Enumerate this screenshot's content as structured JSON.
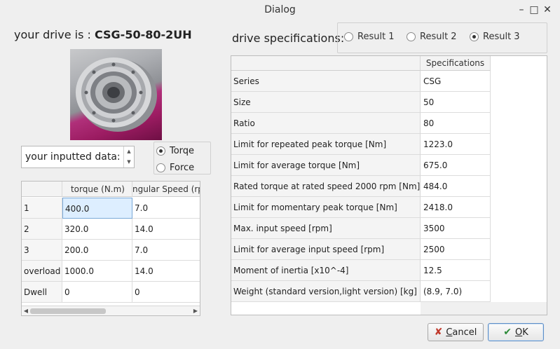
{
  "window": {
    "title": "Dialog",
    "minimize": "–",
    "maximize": "□",
    "close": "✕"
  },
  "drive": {
    "prefix": "your drive is : ",
    "name": "CSG-50-80-2UH"
  },
  "input_spin": {
    "text": "your inputted data:"
  },
  "mode_radios": [
    {
      "label": "Torqe",
      "checked": true
    },
    {
      "label": "Force",
      "checked": false
    }
  ],
  "input_table": {
    "headers": [
      "",
      "torque (N.m)",
      "ngular Speed (rpm"
    ],
    "rows": [
      {
        "label": "1",
        "values": [
          "400.0",
          "7.0"
        ]
      },
      {
        "label": "2",
        "values": [
          "320.0",
          "14.0"
        ]
      },
      {
        "label": "3",
        "values": [
          "200.0",
          "7.0"
        ]
      },
      {
        "label": "overload",
        "values": [
          "1000.0",
          "14.0"
        ]
      },
      {
        "label": "Dwell",
        "values": [
          "0",
          "0"
        ]
      }
    ]
  },
  "spec_label": "drive specifications:",
  "results": [
    {
      "label": "Result 1",
      "checked": false
    },
    {
      "label": "Result 2",
      "checked": false
    },
    {
      "label": "Result 3",
      "checked": true
    }
  ],
  "spec_table": {
    "header": "Specifications",
    "rows": [
      {
        "label": "Series",
        "value": "CSG"
      },
      {
        "label": "Size",
        "value": "50"
      },
      {
        "label": "Ratio",
        "value": "80"
      },
      {
        "label": "Limit for repeated peak torque [Nm]",
        "value": "1223.0"
      },
      {
        "label": "Limit for average torque [Nm]",
        "value": "675.0"
      },
      {
        "label": "Rated torque at rated speed 2000 rpm [Nm]",
        "value": "484.0"
      },
      {
        "label": "Limit for momentary peak torque [Nm]",
        "value": "2418.0"
      },
      {
        "label": "Max. input speed [rpm]",
        "value": "3500"
      },
      {
        "label": "Limit for average input speed [rpm]",
        "value": "2500"
      },
      {
        "label": "Moment of inertia [x10^-4]",
        "value": "12.5"
      },
      {
        "label": "Weight (standard version,light version) [kg]",
        "value": "(8.9, 7.0)"
      }
    ]
  },
  "buttons": {
    "cancel": {
      "first": "C",
      "rest": "ancel"
    },
    "ok": {
      "first": "O",
      "rest": "K"
    }
  }
}
